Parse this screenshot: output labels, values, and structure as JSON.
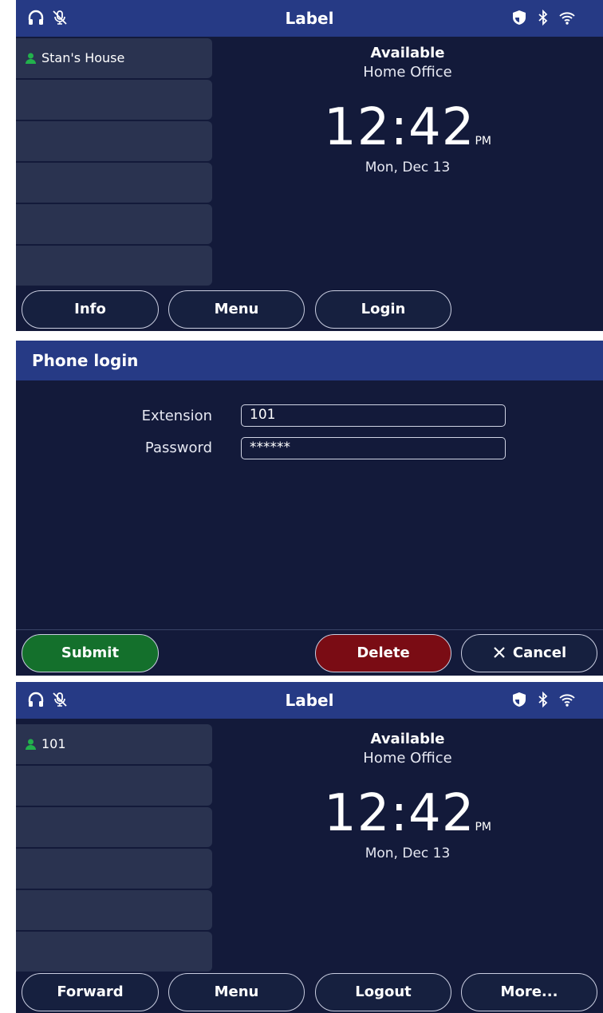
{
  "screen1": {
    "title": "Label",
    "line_keys": [
      "Stan's House",
      "",
      "",
      "",
      "",
      ""
    ],
    "status": "Available",
    "location": "Home Office",
    "time": "12:42",
    "ampm": "PM",
    "date": "Mon, Dec 13",
    "softkeys": [
      "Info",
      "Menu",
      "Login"
    ]
  },
  "screen2": {
    "title": "Phone login",
    "extension_label": "Extension",
    "extension_value": "101",
    "password_label": "Password",
    "password_value": "******",
    "softkeys": {
      "submit": "Submit",
      "delete": "Delete",
      "cancel": "Cancel"
    }
  },
  "screen3": {
    "title": "Label",
    "line_keys": [
      "101",
      "",
      "",
      "",
      "",
      ""
    ],
    "status": "Available",
    "location": "Home Office",
    "time": "12:42",
    "ampm": "PM",
    "date": "Mon, Dec 13",
    "softkeys": [
      "Forward",
      "Menu",
      "Logout",
      "More..."
    ]
  },
  "icons": {
    "left": [
      "headset-icon",
      "mute-icon"
    ],
    "right": [
      "shield-icon",
      "bluetooth-icon",
      "wifi-icon"
    ]
  },
  "colors": {
    "statusbar": "#263a85",
    "screen_bg": "#131a3a",
    "line_key_bg": "#2a3350",
    "presence_green": "#22b14c",
    "submit_green": "#14702c",
    "delete_red": "#7a0c14"
  }
}
